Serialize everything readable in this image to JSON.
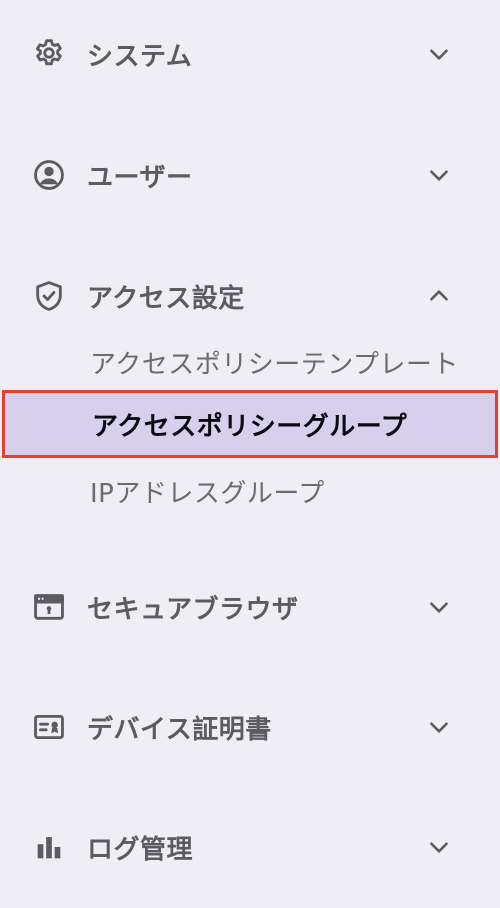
{
  "colors": {
    "background": "#efeef5",
    "icon": "#5b5a65",
    "active_bg": "#d7d0ec",
    "active_border": "#e2412d"
  },
  "sidebar": {
    "sections": [
      {
        "label": "システム",
        "icon": "gear-icon",
        "expanded": false
      },
      {
        "label": "ユーザー",
        "icon": "user-circle-icon",
        "expanded": false
      },
      {
        "label": "アクセス設定",
        "icon": "shield-check-icon",
        "expanded": true,
        "items": [
          {
            "label": "アクセスポリシーテンプレート",
            "active": false
          },
          {
            "label": "アクセスポリシーグループ",
            "active": true
          },
          {
            "label": "IPアドレスグループ",
            "active": false
          }
        ]
      },
      {
        "label": "セキュアブラウザ",
        "icon": "secure-browser-icon",
        "expanded": false
      },
      {
        "label": "デバイス証明書",
        "icon": "certificate-icon",
        "expanded": false
      },
      {
        "label": "ログ管理",
        "icon": "bar-chart-icon",
        "expanded": false
      }
    ]
  }
}
